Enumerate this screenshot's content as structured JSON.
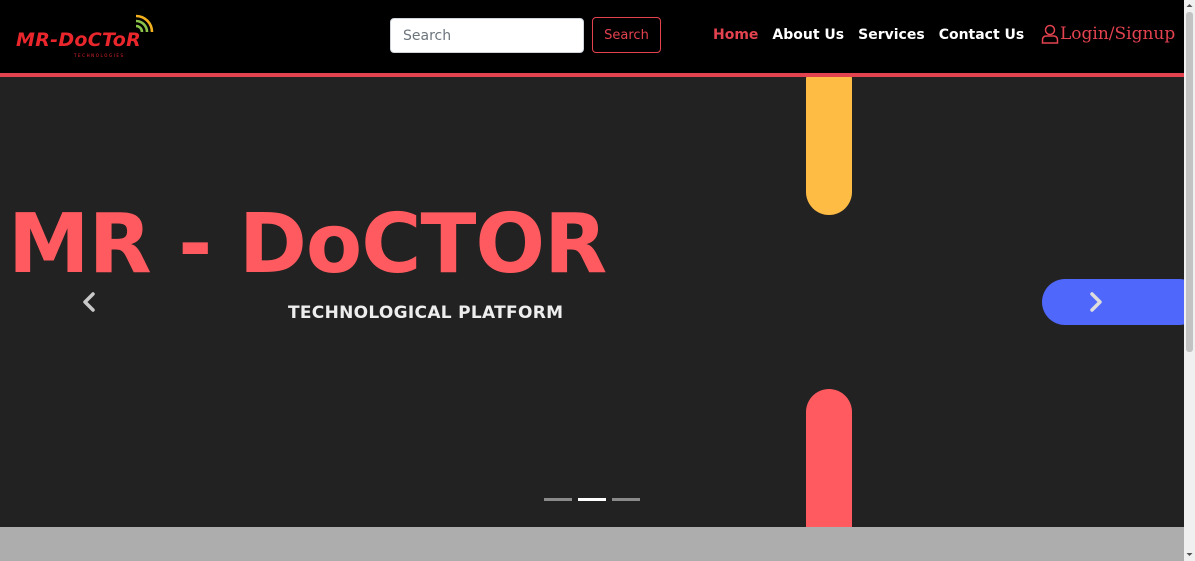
{
  "brand": {
    "logo_text": "MR-DoCToR",
    "logo_subtext": "TECHNOLOGIES"
  },
  "search": {
    "placeholder": "Search",
    "button_label": "Search"
  },
  "nav": {
    "items": [
      {
        "label": "Home",
        "active": true
      },
      {
        "label": "About Us",
        "active": false
      },
      {
        "label": "Services",
        "active": false
      },
      {
        "label": "Contact Us",
        "active": false
      }
    ],
    "login_label": "Login/Signup"
  },
  "hero": {
    "title": "MR - DoCTOR",
    "subtitle": "TECHNOLOGICAL PLATFORM"
  },
  "carousel": {
    "slide_count": 3,
    "active_index": 1
  },
  "colors": {
    "accent": "#e3424f",
    "hero_text": "#ff5a5f",
    "pill_yellow": "#ffbc45",
    "pill_red": "#ff5a5f",
    "pill_blue": "#5067fb",
    "nav_bg": "#000000",
    "carousel_bg": "#222222"
  },
  "icons": {
    "login": "user-icon",
    "prev": "chevron-left-icon",
    "next": "chevron-right-icon",
    "logo_signal": "wifi-signal-icon"
  }
}
